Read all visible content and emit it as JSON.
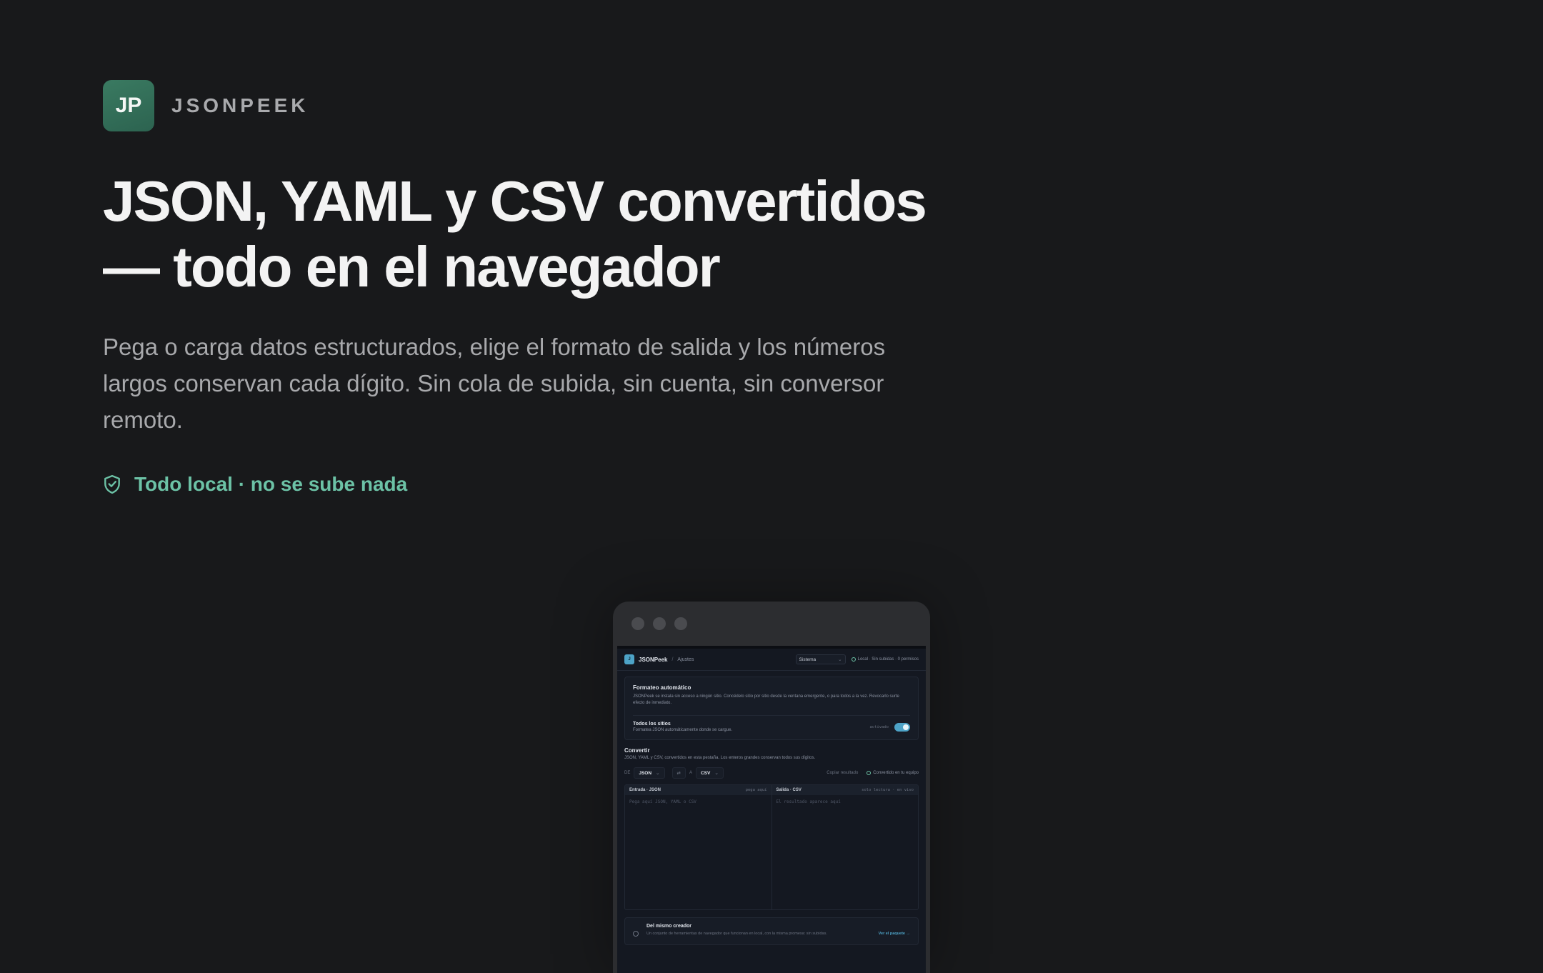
{
  "brand": {
    "logo_text": "JP",
    "name": "JSONPEEK"
  },
  "hero": {
    "headline": "JSON, YAML y CSV convertidos — todo en el navegador",
    "subtitle": "Pega o carga datos estructurados, elige el formato de salida y los números largos conservan cada dígito. Sin cola de subida, sin cuenta, sin conversor remoto.",
    "badge_icon": "shield-check-icon",
    "badge_text": "Todo local · no se sube nada"
  },
  "mockup": {
    "app": {
      "logo_text": "J",
      "name": "JSONPeek",
      "separator": "/",
      "crumb": "Ajustes",
      "theme_value": "Sistema",
      "local_status": "Local · Sin subidas · 0 permisos"
    },
    "auto_format": {
      "title": "Formateo automático",
      "description": "JSONPeek se instala sin acceso a ningún sitio. Concédelo sitio por sitio desde la ventana emergente, o para todos a la vez. Revocarlo surte efecto de inmediato.",
      "row_title": "Todos los sitios",
      "row_sub": "Formatea JSON automáticamente donde se cargue.",
      "row_state": "activado"
    },
    "convert": {
      "title": "Convertir",
      "description": "JSON, YAML y CSV, convertidos en esta pestaña. Los enteros grandes conservan todos sus dígitos.",
      "from_label": "DE",
      "from_value": "JSON",
      "to_label": "A",
      "to_value": "CSV",
      "copy_label": "Copiar resultado",
      "status": "Convertido en tu equipo",
      "input_title": "Entrada · JSON",
      "input_meta": "pega aquí",
      "input_placeholder": "Pega aquí JSON, YAML o CSV",
      "output_title": "Salida · CSV",
      "output_meta": "solo lectura · en vivo",
      "output_placeholder": "El resultado aparece aquí"
    },
    "creator": {
      "title": "Del mismo creador",
      "text": "Un conjunto de herramientas de navegador que funcionan en local, con la misma promesa: sin subidas.",
      "link": "Ver el paquete →"
    }
  },
  "colors": {
    "background": "#18191b",
    "accent_green": "#6cc2a6",
    "logo_green": "#3a7a61",
    "accent_blue": "#4da3c7"
  }
}
